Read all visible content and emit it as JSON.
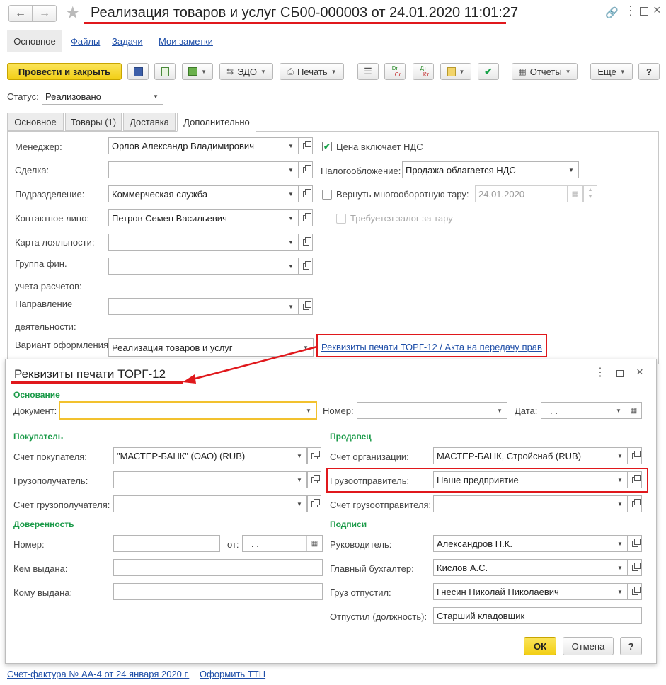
{
  "window": {
    "title": "Реализация товаров и услуг СБ00-000003 от 24.01.2020 11:01:27"
  },
  "nav": {
    "tabs": [
      "Основное",
      "Файлы",
      "Задачи",
      "Мои заметки"
    ]
  },
  "toolbar": {
    "post_close": "Провести и закрыть",
    "edo": "ЭДО",
    "print": "Печать",
    "reports": "Отчеты",
    "more": "Еще",
    "help": "?",
    "dt_kt": {
      "dr": "Dr",
      "cr": "Cr",
      "dt": "Дт",
      "kt": "Кт"
    }
  },
  "status": {
    "label": "Статус:",
    "value": "Реализовано"
  },
  "tabs": [
    "Основное",
    "Товары (1)",
    "Доставка",
    "Дополнительно"
  ],
  "form": {
    "manager_label": "Менеджер:",
    "manager": "Орлов Александр Владимирович",
    "deal_label": "Сделка:",
    "deal": "",
    "dept_label": "Подразделение:",
    "dept": "Коммерческая служба",
    "contact_label": "Контактное лицо:",
    "contact": "Петров Семен Васильевич",
    "loyalty_label": "Карта лояльности:",
    "loyalty": "",
    "fin_group_label1": "Группа фин.",
    "fin_group_label2": "учета расчетов:",
    "fin_group": "",
    "direction_label1": "Направление",
    "direction_label2": "деятельности:",
    "direction": "",
    "variant_label": "Вариант оформления",
    "variant": "Реализация товаров и услуг",
    "vat_included": "Цена включает НДС",
    "tax_label": "Налогообложение:",
    "tax": "Продажа облагается НДС",
    "return_tara": "Вернуть многооборотную тару:",
    "return_date": "24.01.2020",
    "deposit": "Требуется залог за тару",
    "torg_link": "Реквизиты печати ТОРГ-12 / Акта на передачу прав"
  },
  "dialog": {
    "title": "Реквизиты печати ТОРГ-12",
    "basis": "Основание",
    "doc_label": "Документ:",
    "doc": "",
    "num_label": "Номер:",
    "num": "",
    "date_label": "Дата:",
    "date": ". .",
    "buyer": "Покупатель",
    "buyer_account_label": "Счет покупателя:",
    "buyer_account": "\"МАСТЕР-БАНК\" (ОАО) (RUB)",
    "consignee_label": "Грузополучатель:",
    "consignee": "",
    "consignee_account_label": "Счет грузополучателя:",
    "consignee_account": "",
    "proxy": "Доверенность",
    "proxy_num_label": "Номер:",
    "proxy_from_label": "от:",
    "proxy_date": ". .",
    "issued_by_label": "Кем выдана:",
    "issued_to_label": "Кому выдана:",
    "seller": "Продавец",
    "org_account_label": "Счет организации:",
    "org_account": "МАСТЕР-БАНК, Стройснаб (RUB)",
    "shipper_label": "Грузоотправитель:",
    "shipper": "Наше предприятие",
    "shipper_account_label": "Счет грузоотправителя:",
    "shipper_account": "",
    "signatures": "Подписи",
    "head_label": "Руководитель:",
    "head": "Александров П.К.",
    "accountant_label": "Главный бухгалтер:",
    "accountant": "Кислов А.С.",
    "released_label": "Груз отпустил:",
    "released": "Гнесин Николай Николаевич",
    "position_label": "Отпустил (должность):",
    "position": "Старший кладовщик",
    "ok": "ОК",
    "cancel": "Отмена",
    "help": "?"
  },
  "footer": {
    "invoice": "Счет-фактура № АА-4 от 24 января 2020 г.",
    "ttn": "Оформить ТТН"
  },
  "colors": {
    "accent_yellow": "#f5d82a",
    "link": "#1f4fa8",
    "section_green": "#1a9a48",
    "annotation_red": "#e0181c"
  }
}
